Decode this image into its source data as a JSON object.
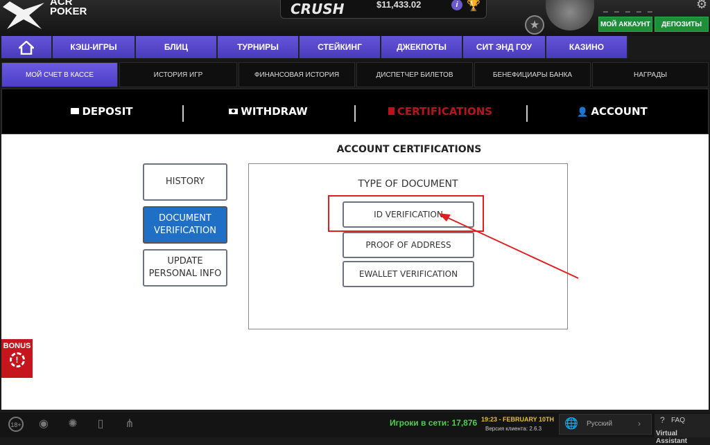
{
  "header": {
    "logo_text": "ACR POKER",
    "logo_line1": "ACR",
    "logo_line2": "POKER",
    "banner_logo": "CRUSH",
    "balance": "$11,433.02",
    "info_icon": "info-icon",
    "trophy_icon": "trophy-icon",
    "account_name": "_ _ _ _ _",
    "my_account_label": "МОЙ АККАУНТ",
    "deposit_label": "ДЕПОЗИТЫ",
    "settings_icon": "gear-icon"
  },
  "main_nav": {
    "home_icon": "home-icon",
    "items": [
      "КЭШ-ИГРЫ",
      "БЛИЦ",
      "ТУРНИРЫ",
      "СТЕЙКИНГ",
      "ДЖЕКПОТЫ",
      "СИТ ЭНД ГОУ",
      "КАЗИНО"
    ]
  },
  "sub_nav": {
    "items": [
      "МОЙ СЧЕТ В КАССЕ",
      "ИСТОРИЯ ИГР",
      "ФИНАНСОВАЯ ИСТОРИЯ",
      "ДИСПЕТЧЕР БИЛЕТОВ",
      "БЕНЕФИЦИАРЫ БАНКА",
      "НАГРАДЫ"
    ],
    "active_index": 0
  },
  "cashier_tabs": {
    "items": [
      "DEPOSIT",
      "WITHDRAW",
      "CERTIFICATIONS",
      "ACCOUNT"
    ],
    "icons": [
      "card-icon",
      "cash-icon",
      "document-icon",
      "user-icon"
    ],
    "active_index": 2
  },
  "page": {
    "title": "ACCOUNT CERTIFICATIONS"
  },
  "side_menu": {
    "history": "HISTORY",
    "document_verification_line1": "DOCUMENT",
    "document_verification_line2": "VERIFICATION",
    "update_info_line1": "UPDATE",
    "update_info_line2": "PERSONAL INFO",
    "active": "DOCUMENT VERIFICATION"
  },
  "document_panel": {
    "title": "TYPE OF DOCUMENT",
    "options": [
      "ID VERIFICATION",
      "PROOF OF ADDRESS",
      "EWALLET VERIFICATION"
    ],
    "highlighted": "ID VERIFICATION"
  },
  "bonus": {
    "label": "BONUS"
  },
  "footer": {
    "age_badge": "18+",
    "online_text": "Игроки в сети: 17,876",
    "datetime": "19:23 - FEBRUARY 10TH",
    "version": "Версия клиента: 2.6.3",
    "language": "Русский",
    "faq": "FAQ",
    "virtual_assistant": "Virtual Assistant"
  },
  "colors": {
    "nav_purple": "#5b4bd0",
    "active_blue": "#1f6fc6",
    "accent_red": "#b3171b",
    "green": "#1d8f3a",
    "online_green": "#4ccf4c"
  }
}
